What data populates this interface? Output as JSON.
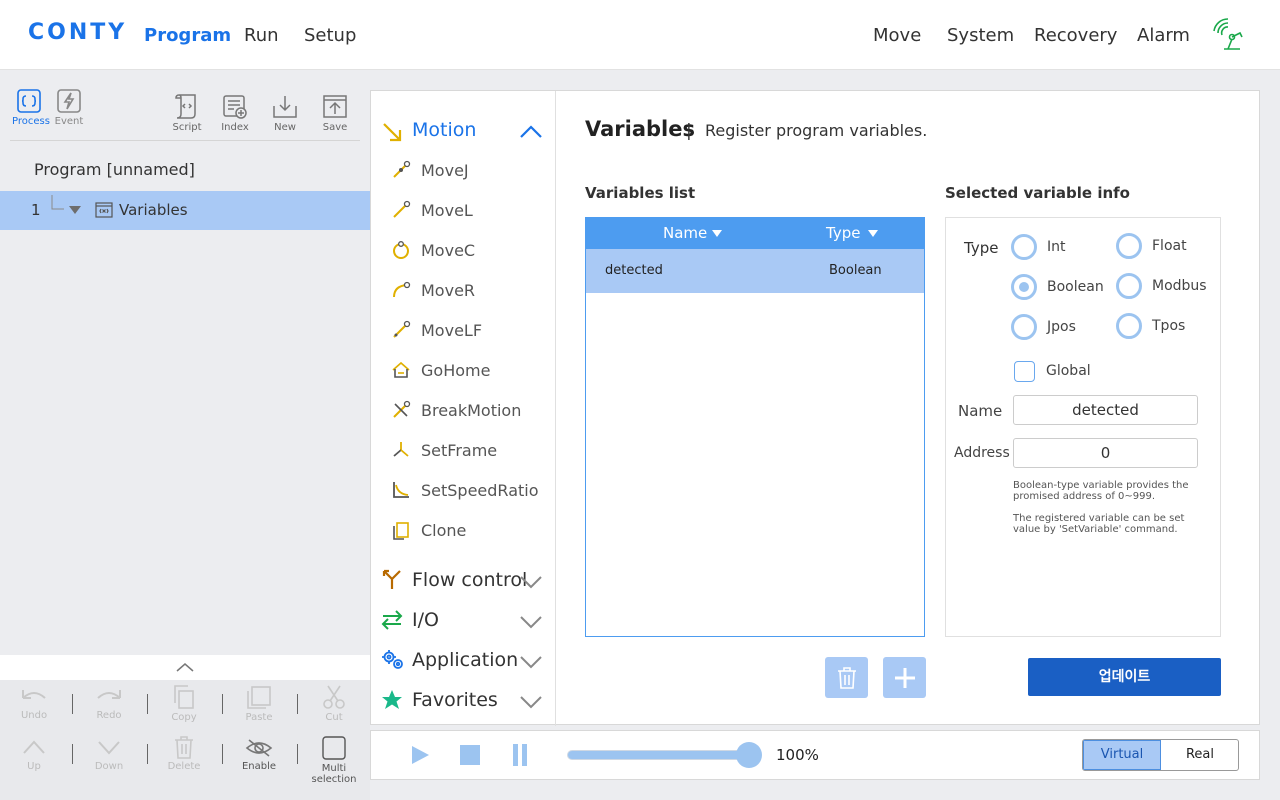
{
  "header": {
    "logo": "CONTY",
    "nav_left": [
      "Program",
      "Run",
      "Setup"
    ],
    "nav_right": [
      "Move",
      "System",
      "Recovery",
      "Alarm"
    ],
    "status_icon": "wireless-robot-icon"
  },
  "toolbar": {
    "process": "Process",
    "event": "Event",
    "script": "Script",
    "index": "Index",
    "new": "New",
    "save": "Save"
  },
  "program": {
    "title": "Program [unnamed]",
    "tree": [
      {
        "line": "1",
        "label": "Variables"
      }
    ]
  },
  "edit_tools": {
    "row1": [
      "Undo",
      "Redo",
      "Copy",
      "Paste",
      "Cut"
    ],
    "row2": [
      "Up",
      "Down",
      "Delete",
      "Enable",
      "Multi selection"
    ]
  },
  "commands": {
    "motion_label": "Motion",
    "motion_items": [
      "MoveJ",
      "MoveL",
      "MoveC",
      "MoveR",
      "MoveLF",
      "GoHome",
      "BreakMotion",
      "SetFrame",
      "SetSpeedRatio",
      "Clone"
    ],
    "categories": [
      "Flow control",
      "I/O",
      "Application",
      "Favorites"
    ]
  },
  "variables": {
    "title": "Variables",
    "separator": "|",
    "subtitle": "Register program variables.",
    "list_header": "Variables list",
    "columns": [
      "Name",
      "Type"
    ],
    "rows": [
      {
        "name": "detected",
        "type": "Boolean"
      }
    ]
  },
  "info": {
    "header": "Selected variable info",
    "type_label": "Type",
    "types": [
      "Int",
      "Float",
      "Boolean",
      "Modbus",
      "Jpos",
      "Tpos"
    ],
    "selected_type": "Boolean",
    "global_label": "Global",
    "global_checked": false,
    "name_label": "Name",
    "name_value": "detected",
    "address_label": "Address",
    "address_value": "0",
    "note1": "Boolean-type variable provides the promised address of 0~999.",
    "note2": "The registered variable can be set value by 'SetVariable' command.",
    "update_button": "업데이트"
  },
  "runbar": {
    "speed_value": 100,
    "speed_label": "100%",
    "mode_virtual": "Virtual",
    "mode_real": "Real",
    "active_mode": "Virtual"
  },
  "colors": {
    "accent": "#1a73e8",
    "selection": "#a9c9f5",
    "table_header": "#4d9cf0",
    "update_button": "#1a5fc4",
    "motion_icon": "#e0b000"
  }
}
